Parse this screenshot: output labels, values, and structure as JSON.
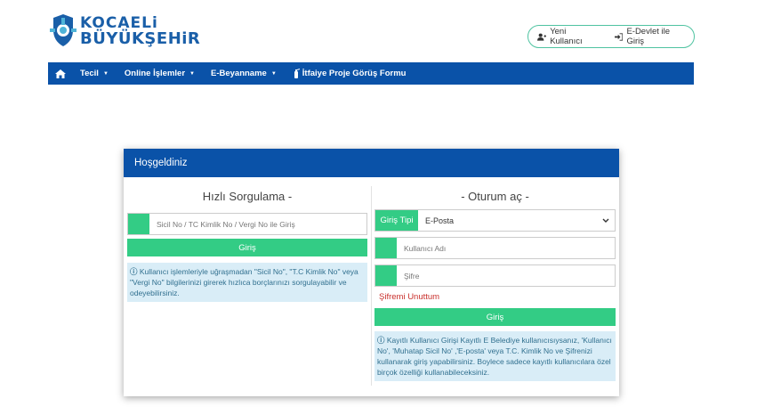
{
  "logo": {
    "line1": "KOCAELi",
    "line2": "BÜYÜKŞEHiR"
  },
  "header": {
    "new_user": "Yeni Kullanıcı",
    "edevlet": "E-Devlet ile Giriş"
  },
  "nav": {
    "items": [
      {
        "label": "Tecil"
      },
      {
        "label": "Online İşlemler"
      },
      {
        "label": "E-Beyanname"
      },
      {
        "label": "İtfaiye Proje Görüş Formu"
      }
    ]
  },
  "card": {
    "title": "Hoşgeldiniz",
    "left": {
      "title": "Hızlı Sorgulama -",
      "input_placeholder": "Sicil No / TC Kimlik No / Vergi No ile Giriş",
      "button": "Giriş",
      "info": "Kullanıcı işlemleriyle uğraşmadan \"Sicil No\", \"T.C Kimlik No\" veya \"Vergi No\" bilgilerinizi girerek hızlıca borçlarınızı sorgulayabilir ve odeyebilirsiniz."
    },
    "right": {
      "title": "- Oturum aç -",
      "login_type_label": "Giriş Tipi",
      "login_type_value": "E-Posta",
      "username_placeholder": "Kullanıcı Adı",
      "password_placeholder": "Şifre",
      "forgot": "Şifremi Unuttum",
      "button": "Giriş",
      "info": "Kayıtlı Kullanıcı Girişi Kayıtlı E Belediye kullanıcısıysanız, 'Kullanıcı No', 'Muhatap Sicil No' ,'E-posta' veya T.C. Kimlik No ve Şifrenizi kullanarak giriş yapabilirsiniz. Boylece sadece kayıtlı kullanıcılara özel birçok özelliği kullanabileceksiniz."
    }
  },
  "colors": {
    "primary": "#0a52a8",
    "accent": "#33cc85",
    "logo": "#1a5fa8"
  },
  "icons": [
    "logo-mark-icon",
    "add-user-icon",
    "sign-in-icon",
    "home-icon",
    "fire-extinguisher-icon",
    "info-icon",
    "chevron-down-icon"
  ]
}
